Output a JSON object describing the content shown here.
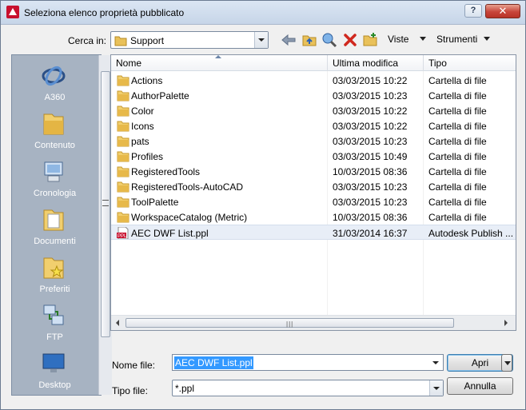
{
  "window": {
    "title": "Seleziona elenco proprietà pubblicato",
    "help_label": "?",
    "close_label": "✕"
  },
  "toolbar": {
    "look_in_label": "Cerca in:",
    "look_in_value": "Support",
    "views_label": "Viste",
    "tools_label": "Strumenti"
  },
  "places": [
    {
      "label": "A360",
      "icon": "a360-icon"
    },
    {
      "label": "Contenuto",
      "icon": "folder-icon"
    },
    {
      "label": "Cronologia",
      "icon": "history-icon"
    },
    {
      "label": "Documenti",
      "icon": "documents-icon"
    },
    {
      "label": "Preferiti",
      "icon": "favorites-icon"
    },
    {
      "label": "FTP",
      "icon": "ftp-icon"
    },
    {
      "label": "Desktop",
      "icon": "desktop-icon"
    }
  ],
  "file_list": {
    "columns": {
      "name": "Nome",
      "modified": "Ultima modifica",
      "type": "Tipo"
    },
    "rows": [
      {
        "name": "Actions",
        "modified": "03/03/2015 10:22",
        "type": "Cartella di file",
        "icon": "folder-icon"
      },
      {
        "name": "AuthorPalette",
        "modified": "03/03/2015 10:23",
        "type": "Cartella di file",
        "icon": "folder-icon"
      },
      {
        "name": "Color",
        "modified": "03/03/2015 10:22",
        "type": "Cartella di file",
        "icon": "folder-icon"
      },
      {
        "name": "Icons",
        "modified": "03/03/2015 10:22",
        "type": "Cartella di file",
        "icon": "folder-icon"
      },
      {
        "name": "pats",
        "modified": "03/03/2015 10:23",
        "type": "Cartella di file",
        "icon": "folder-icon"
      },
      {
        "name": "Profiles",
        "modified": "03/03/2015 10:49",
        "type": "Cartella di file",
        "icon": "folder-icon"
      },
      {
        "name": "RegisteredTools",
        "modified": "10/03/2015 08:36",
        "type": "Cartella di file",
        "icon": "folder-icon"
      },
      {
        "name": "RegisteredTools-AutoCAD",
        "modified": "03/03/2015 10:23",
        "type": "Cartella di file",
        "icon": "folder-icon"
      },
      {
        "name": "ToolPalette",
        "modified": "03/03/2015 10:23",
        "type": "Cartella di file",
        "icon": "folder-icon"
      },
      {
        "name": "WorkspaceCatalog (Metric)",
        "modified": "10/03/2015 08:36",
        "type": "Cartella di file",
        "icon": "folder-icon"
      },
      {
        "name": "AEC DWF List.ppl",
        "modified": "31/03/2014 16:37",
        "type": "Autodesk Publish ...",
        "icon": "ppl-file-icon"
      }
    ]
  },
  "footer": {
    "file_name_label": "Nome file:",
    "file_name_value": "AEC DWF List.ppl",
    "file_type_label": "Tipo file:",
    "file_type_value": "*.ppl",
    "open_label": "Apri",
    "cancel_label": "Annulla"
  },
  "colors": {
    "accent": "#3399ff",
    "close": "#c8453a",
    "places_bg": "#a7b3c2"
  }
}
